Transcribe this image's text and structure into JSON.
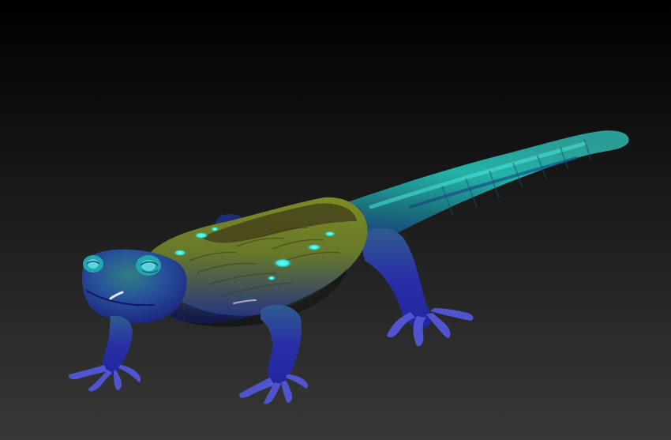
{
  "scene": {
    "subject": "salamander-3d-model",
    "colors": {
      "background_top": "#000000",
      "background_bottom": "#383838",
      "body_blue": "#2a2fa6",
      "body_deep_blue": "#1d1f7e",
      "body_teal": "#1c8c86",
      "back_olive": "#8a8a20",
      "back_dark": "#4f4a1a",
      "spot_cyan": "#35f0ea",
      "toe_lavender": "#6c6fe0",
      "highlight": "#d8dcff"
    }
  }
}
